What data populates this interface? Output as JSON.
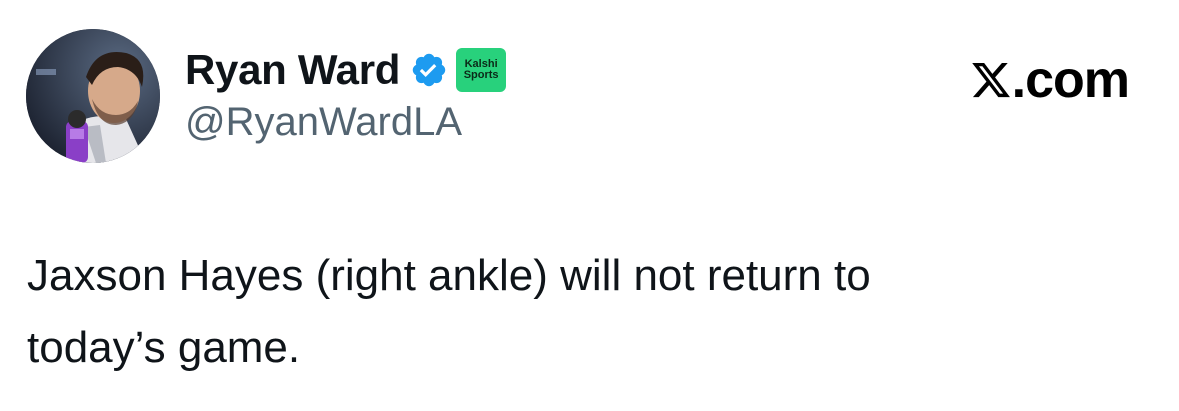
{
  "author": {
    "display_name": "Ryan Ward",
    "handle": "@RyanWardLA",
    "verified_color": "#1d9bf0",
    "affiliate_badge": {
      "line1": "Kalshi",
      "line2": "Sports",
      "color": "#28d17c"
    }
  },
  "site": {
    "domain_suffix": ".com",
    "icon": "x-logo-icon"
  },
  "tweet": {
    "line1": "Jaxson Hayes (right ankle) will not return to",
    "line2": "today’s game."
  }
}
